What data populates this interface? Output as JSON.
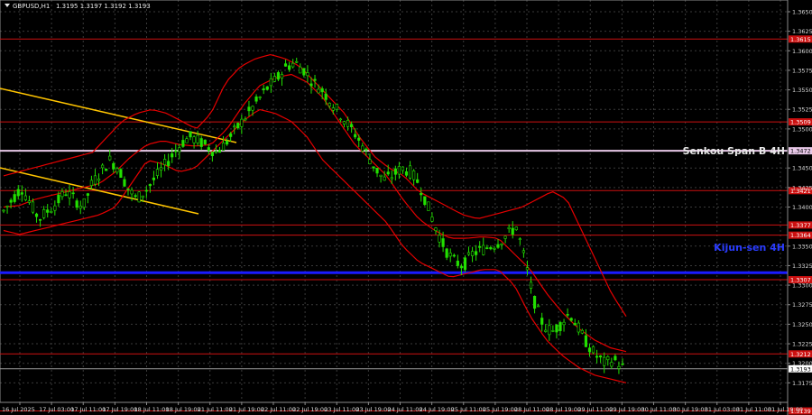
{
  "header": {
    "symbol": "GBPUSD,H1",
    "ohlc": "1.3195 1.3197 1.3192 1.3193"
  },
  "colors": {
    "background": "#000000",
    "bull": "#22e000",
    "bear": "#2a6a2a",
    "bollinger": "#e60000",
    "level": "#cc1010",
    "senkou": "#e8c8e8",
    "kijun": "#1a1aff",
    "trendline": "#ffc400"
  },
  "chart_data": {
    "type": "candlestick",
    "title": "",
    "ylim": [
      1.315,
      1.3665
    ],
    "y_ticks": [
      "1.3650",
      "1.3625",
      "1.3600",
      "1.3575",
      "1.3550",
      "1.3525",
      "1.3500",
      "1.3450",
      "1.3425",
      "1.3400",
      "1.3350",
      "1.3325",
      "1.3300",
      "1.3275",
      "1.3250",
      "1.3225",
      "1.3200",
      "1.3175"
    ],
    "x_ticks": [
      "16 Jul 2025",
      "17 Jul 03:00",
      "17 Jul 11:00",
      "17 Jul 19:00",
      "18 Jul 11:00",
      "18 Jul 19:00",
      "21 Jul 11:00",
      "21 Jul 19:00",
      "22 Jul 11:00",
      "22 Jul 19:00",
      "23 Jul 11:00",
      "23 Jul 19:00",
      "24 Jul 11:00",
      "24 Jul 19:00",
      "25 Jul 11:00",
      "25 Jul 19:00",
      "28 Jul 11:00",
      "28 Jul 19:00",
      "29 Jul 11:00",
      "29 Jul 19:00",
      "30 Jul 11:00",
      "30 Jul 19:00",
      "31 Jul 03:00",
      "31 Jul 11:00",
      "31 Jul 19:00"
    ],
    "price_path": [
      1.3395,
      1.341,
      1.3425,
      1.3405,
      1.3385,
      1.3395,
      1.3405,
      1.342,
      1.341,
      1.34,
      1.343,
      1.3445,
      1.346,
      1.345,
      1.3425,
      1.341,
      1.342,
      1.3435,
      1.345,
      1.3465,
      1.348,
      1.349,
      1.3485,
      1.3478,
      1.347,
      1.348,
      1.3495,
      1.351,
      1.3525,
      1.354,
      1.3555,
      1.3565,
      1.358,
      1.3585,
      1.3575,
      1.356,
      1.355,
      1.3535,
      1.352,
      1.3505,
      1.349,
      1.347,
      1.345,
      1.3435,
      1.344,
      1.345,
      1.3445,
      1.343,
      1.34,
      1.337,
      1.3345,
      1.333,
      1.3325,
      1.334,
      1.3345,
      1.335,
      1.3355,
      1.3365,
      1.3375,
      1.333,
      1.328,
      1.325,
      1.324,
      1.325,
      1.3265,
      1.3245,
      1.3225,
      1.321,
      1.32,
      1.3205,
      1.3195
    ],
    "bollinger_upper_path": [
      1.344,
      1.3445,
      1.345,
      1.3455,
      1.346,
      1.3465,
      1.347,
      1.349,
      1.351,
      1.352,
      1.3525,
      1.352,
      1.351,
      1.35,
      1.352,
      1.356,
      1.358,
      1.359,
      1.3595,
      1.359,
      1.358,
      1.356,
      1.354,
      1.352,
      1.349,
      1.3465,
      1.345,
      1.344,
      1.342,
      1.341,
      1.34,
      1.339,
      1.3385,
      1.339,
      1.3395,
      1.34,
      1.341,
      1.342,
      1.341,
      1.337,
      1.333,
      1.329,
      1.326
    ],
    "bollinger_lower_path": [
      1.337,
      1.3365,
      1.337,
      1.3375,
      1.338,
      1.3385,
      1.339,
      1.34,
      1.343,
      1.346,
      1.3455,
      1.3445,
      1.345,
      1.347,
      1.349,
      1.351,
      1.3525,
      1.352,
      1.351,
      1.349,
      1.346,
      1.344,
      1.342,
      1.34,
      1.338,
      1.335,
      1.333,
      1.332,
      1.331,
      1.3315,
      1.332,
      1.332,
      1.33,
      1.326,
      1.323,
      1.321,
      1.3195,
      1.3185,
      1.318,
      1.3175
    ],
    "bollinger_mid_path": [
      1.34,
      1.3402,
      1.341,
      1.3415,
      1.342,
      1.3425,
      1.343,
      1.3445,
      1.3465,
      1.348,
      1.3485,
      1.348,
      1.3478,
      1.348,
      1.35,
      1.353,
      1.3555,
      1.3565,
      1.357,
      1.356,
      1.354,
      1.351,
      1.348,
      1.346,
      1.344,
      1.341,
      1.3385,
      1.337,
      1.336,
      1.336,
      1.3362,
      1.336,
      1.334,
      1.332,
      1.329,
      1.3265,
      1.3245,
      1.323,
      1.322,
      1.3215
    ],
    "levels": [
      {
        "price": 1.3615,
        "label": "1.3615",
        "kind": "red"
      },
      {
        "price": 1.3509,
        "label": "1.3509",
        "kind": "red"
      },
      {
        "price": 1.3472,
        "label": "1.3472",
        "kind": "senkou"
      },
      {
        "price": 1.3421,
        "label": "1.3421",
        "kind": "red"
      },
      {
        "price": 1.3377,
        "label": "1.3377",
        "kind": "red"
      },
      {
        "price": 1.3364,
        "label": "1.3364",
        "kind": "red"
      },
      {
        "price": 1.3316,
        "label": "",
        "kind": "kijun"
      },
      {
        "price": 1.3307,
        "label": "1.3307",
        "kind": "red"
      },
      {
        "price": 1.3212,
        "label": "1.3212",
        "kind": "red"
      },
      {
        "price": 1.3193,
        "label": "1.3193",
        "kind": "current"
      },
      {
        "price": 1.3139,
        "label": "1.3139",
        "kind": "red"
      }
    ],
    "annotations": {
      "senkou": "Senkou Span B 4H",
      "kijun": "Kijun-sen 4H"
    }
  }
}
